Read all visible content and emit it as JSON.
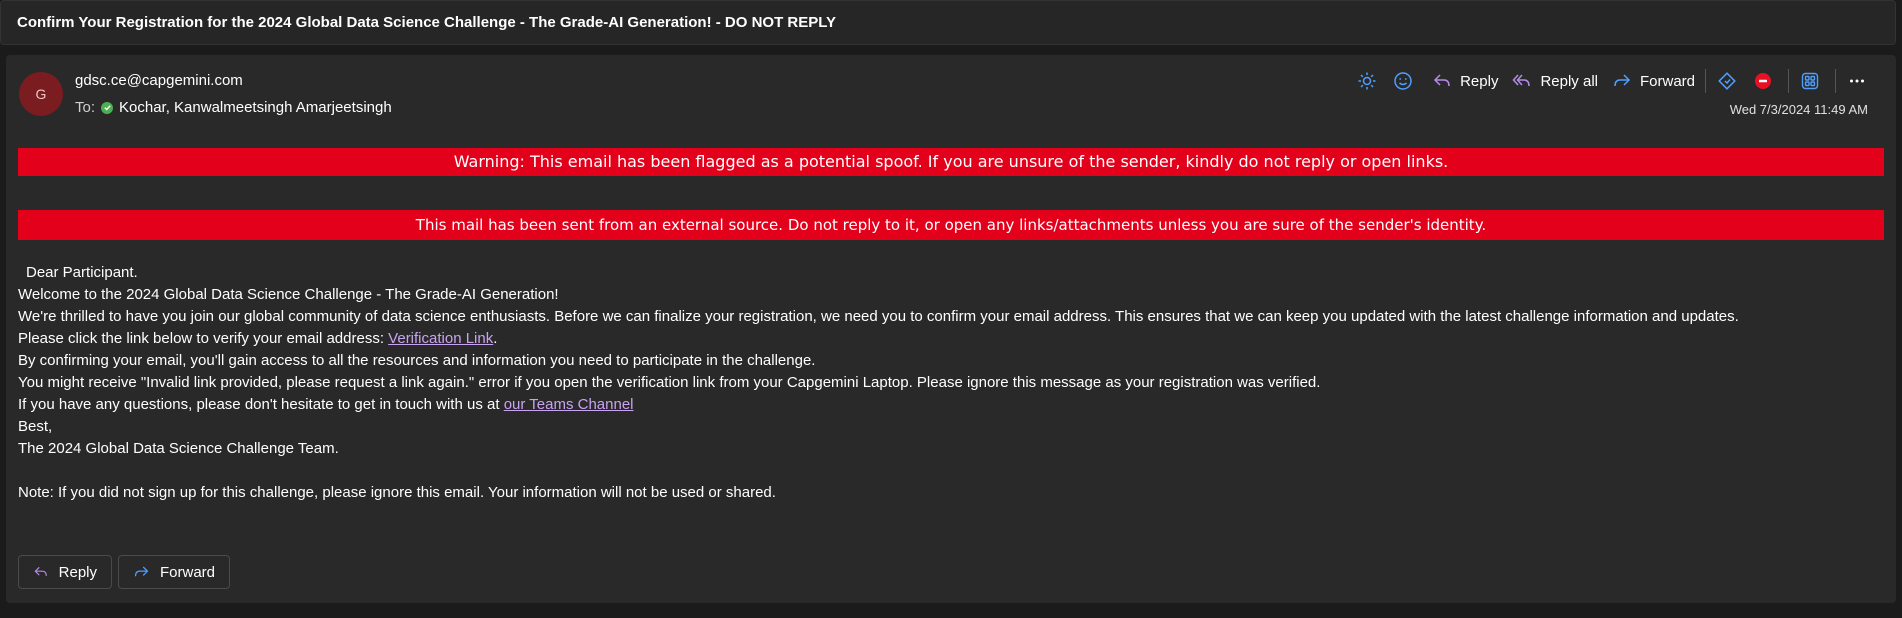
{
  "email": {
    "subject": "Confirm Your Registration for the 2024 Global Data Science Challenge - The Grade-AI Generation! - DO NOT REPLY",
    "avatar_initial": "G",
    "from": "gdsc.ce@capgemini.com",
    "to_label": "To:",
    "to_name": "Kochar, Kanwalmeetsingh Amarjeetsingh",
    "date": "Wed 7/3/2024 11:49 AM"
  },
  "toolbar": {
    "icons": [
      "sun-icon",
      "emoji-icon",
      "reply-icon",
      "reply-all-icon",
      "forward-icon",
      "flag-icon",
      "stop-icon",
      "apps-icon",
      "more-icon"
    ],
    "reply_label": "Reply",
    "reply_all_label": "Reply all",
    "forward_label": "Forward"
  },
  "banners": {
    "spoof_warning": "Warning: This email has been flagged as a potential spoof. If you are unsure of the sender, kindly do not reply or open links.",
    "external_warning": "This mail has been sent from an external source. Do not reply to it, or open any links/attachments unless you are sure of the sender's identity."
  },
  "body": {
    "greeting": "Dear Participant.",
    "welcome": "Welcome to the 2024 Global Data Science Challenge - The Grade-AI Generation!",
    "intro": "We're thrilled to have you join our global community of data science enthusiasts. Before we can finalize your registration, we need you to confirm your email address. This ensures that we can keep you updated with the latest challenge information and updates.",
    "verify_prefix": "Please click the link below to verify your email address: ",
    "verify_link": "Verification Link",
    "verify_suffix": ".",
    "access": "By confirming your email, you'll gain access to all the resources and information you need to participate in the challenge.",
    "invalid_note": "You might receive \"Invalid link provided, please request a link again.\" error if you open the verification link from your Capgemini Laptop. Please ignore this message as your registration was verified.",
    "questions_prefix": "If you have any questions, please don't hesitate to get in touch with us at ",
    "teams_link": "our Teams Channel",
    "sign_off": "Best,",
    "signature": "The 2024 Global Data Science Challenge Team.",
    "note": "Note: If you did not sign up for this challenge, please ignore this email. Your information will not be used or shared."
  },
  "footer": {
    "reply_label": "Reply",
    "forward_label": "Forward"
  },
  "colors": {
    "banner_red": "#e3001b",
    "link_purple": "#c9a3f0",
    "accent_blue": "#4f9fff",
    "reply_purple": "#b48be8",
    "stop_red": "#e81123"
  }
}
